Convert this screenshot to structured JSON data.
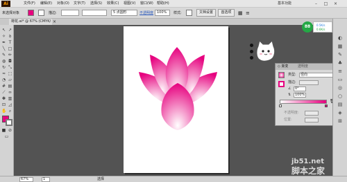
{
  "app": {
    "logo": "Ai",
    "workspace": "基本功能"
  },
  "menu": [
    "文件(F)",
    "编辑(E)",
    "对象(O)",
    "文字(T)",
    "选择(S)",
    "效果(C)",
    "视图(V)",
    "窗口(W)",
    "帮助(H)"
  ],
  "window_controls": [
    "–",
    "□",
    "×"
  ],
  "control": {
    "selection_label": "未选择对象",
    "stroke_label": "描边:",
    "brush_value": "5 点圆形",
    "opacity_link": "不透明度",
    "opacity_value": "100%",
    "style_label": "样式:",
    "doc_setup_button": "文档设置",
    "prefs_button": "首选项"
  },
  "document": {
    "tab_title": "荷花.ai* @ 67% (CMYK/预览)",
    "close": "×"
  },
  "gradient_panel": {
    "tab1": "◇ 渐变",
    "tab2": "透明度",
    "type_label": "类型:",
    "type_value": "径向",
    "stroke_label": "描边:",
    "angle_value": "0°",
    "ratio_value": "100%",
    "opacity_label": "不透明度:",
    "location_label": "位置:",
    "start_color": "#ffffff",
    "end_color": "#e6007e"
  },
  "badge": {
    "value": "88",
    "line1": "0.5K/s",
    "line2": "0.6K/s"
  },
  "statusbar": {
    "zoom": "67%",
    "page": "1",
    "tool": "选择"
  },
  "watermark": {
    "domain": "jb51.net",
    "name": "脚本之家"
  },
  "colors": {
    "lotus": "#e6007e",
    "badge": "#24a845",
    "artboard": "#ffffff",
    "canvas": "#535353"
  }
}
